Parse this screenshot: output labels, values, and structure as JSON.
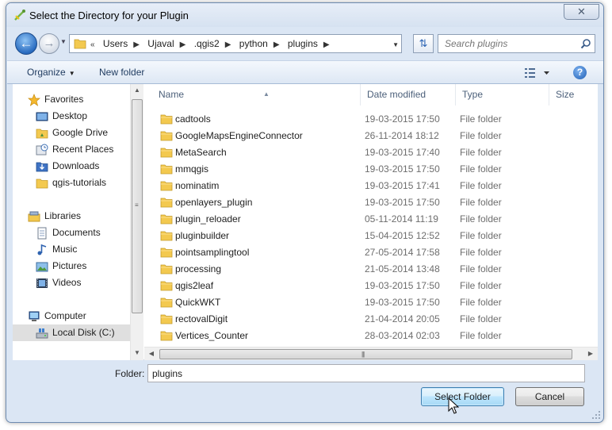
{
  "window": {
    "title": "Select the Directory for your Plugin",
    "close_label": "✕"
  },
  "address": {
    "crumbs": [
      "Users",
      "Ujaval",
      ".qgis2",
      "python",
      "plugins"
    ],
    "overflow": "«"
  },
  "search": {
    "placeholder": "Search plugins"
  },
  "toolbar": {
    "organize_label": "Organize",
    "new_folder_label": "New folder",
    "help_label": "?"
  },
  "nav": {
    "favorites": {
      "label": "Favorites",
      "icon": "star-icon"
    },
    "favorite_items": [
      {
        "label": "Desktop",
        "icon": "desktop-icon"
      },
      {
        "label": "Google Drive",
        "icon": "folder-icon"
      },
      {
        "label": "Recent Places",
        "icon": "recent-places-icon"
      },
      {
        "label": "Downloads",
        "icon": "downloads-icon"
      },
      {
        "label": "qgis-tutorials",
        "icon": "folder-icon"
      }
    ],
    "libraries": {
      "label": "Libraries",
      "icon": "libraries-icon"
    },
    "library_items": [
      {
        "label": "Documents",
        "icon": "documents-icon"
      },
      {
        "label": "Music",
        "icon": "music-icon"
      },
      {
        "label": "Pictures",
        "icon": "pictures-icon"
      },
      {
        "label": "Videos",
        "icon": "videos-icon"
      }
    ],
    "computer": {
      "label": "Computer",
      "icon": "computer-icon"
    },
    "computer_items": [
      {
        "label": "Local Disk (C:)",
        "icon": "local-disk-icon",
        "selected": true
      }
    ]
  },
  "columns": {
    "name": "Name",
    "date": "Date modified",
    "type": "Type",
    "size": "Size"
  },
  "files": [
    {
      "name": "cadtools",
      "date": "19-03-2015 17:50",
      "type": "File folder"
    },
    {
      "name": "GoogleMapsEngineConnector",
      "date": "26-11-2014 18:12",
      "type": "File folder"
    },
    {
      "name": "MetaSearch",
      "date": "19-03-2015 17:40",
      "type": "File folder"
    },
    {
      "name": "mmqgis",
      "date": "19-03-2015 17:50",
      "type": "File folder"
    },
    {
      "name": "nominatim",
      "date": "19-03-2015 17:41",
      "type": "File folder"
    },
    {
      "name": "openlayers_plugin",
      "date": "19-03-2015 17:50",
      "type": "File folder"
    },
    {
      "name": "plugin_reloader",
      "date": "05-11-2014 11:19",
      "type": "File folder"
    },
    {
      "name": "pluginbuilder",
      "date": "15-04-2015 12:52",
      "type": "File folder"
    },
    {
      "name": "pointsamplingtool",
      "date": "27-05-2014 17:58",
      "type": "File folder"
    },
    {
      "name": "processing",
      "date": "21-05-2014 13:48",
      "type": "File folder"
    },
    {
      "name": "qgis2leaf",
      "date": "19-03-2015 17:50",
      "type": "File folder"
    },
    {
      "name": "QuickWKT",
      "date": "19-03-2015 17:50",
      "type": "File folder"
    },
    {
      "name": "rectovalDigit",
      "date": "21-04-2014 20:05",
      "type": "File folder"
    },
    {
      "name": "Vertices_Counter",
      "date": "28-03-2014 02:03",
      "type": "File folder"
    }
  ],
  "folder_field": {
    "label": "Folder:",
    "value": "plugins"
  },
  "buttons": {
    "select_folder": "Select Folder",
    "cancel": "Cancel"
  },
  "colors": {
    "folder": "#f3c94f",
    "accent_blue": "#2a6cc0",
    "dialog_bg": "#dbe6f4"
  }
}
